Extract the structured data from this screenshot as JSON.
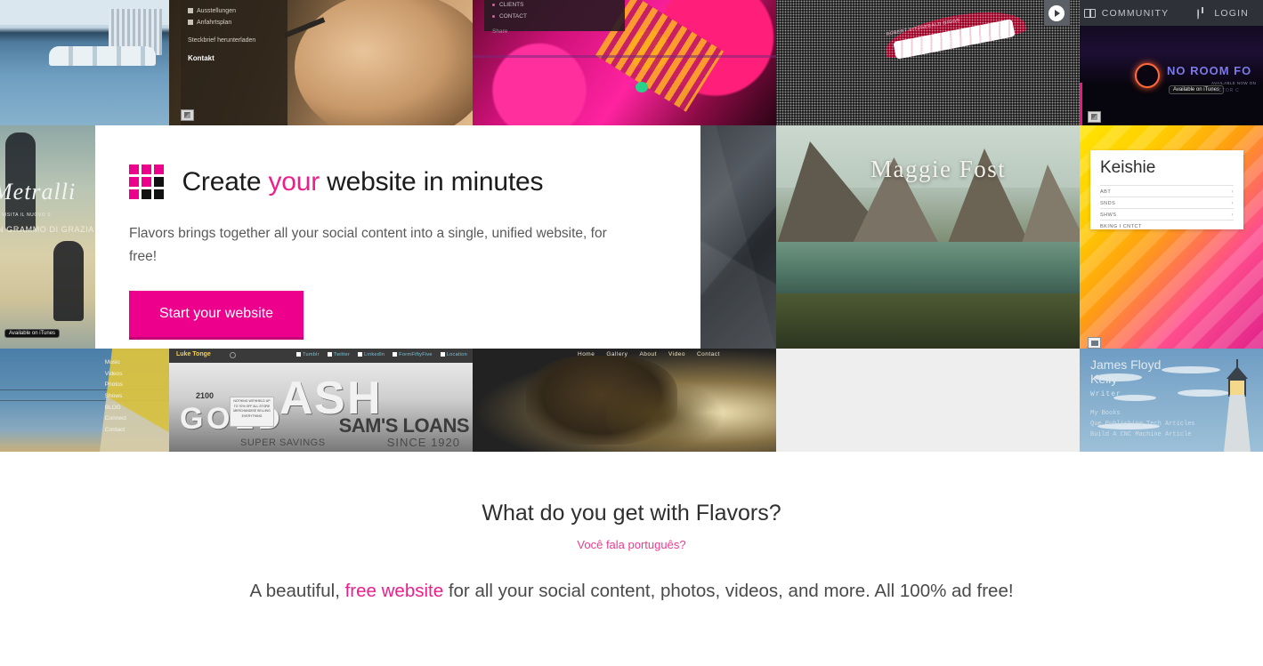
{
  "header": {
    "play_label": "play-video",
    "community_label": "COMMUNITY",
    "login_label": "LOGIN"
  },
  "hero_card": {
    "heading_part1": "Create ",
    "heading_highlight": "your",
    "heading_part2": " website in minutes",
    "paragraph": "Flavors brings together all your social content into a single, unified website, for free!",
    "cta_label": "Start your website",
    "accent_color": "#ec008c",
    "logo_cells": [
      "#ec008c",
      "#ec008c",
      "#ec008c",
      "#ec008c",
      "#ec008c",
      "#111111",
      "#ec008c",
      "#111111",
      "#111111"
    ]
  },
  "tiles": {
    "waiting_room": {
      "name": "waiting-room-site"
    },
    "german_site": {
      "nav": [
        "Ausstellungen",
        "Anfahrtsplan"
      ],
      "download": "Steckbrief herunterladen",
      "contact": "Kontakt"
    },
    "graffiti_site": {
      "nav": [
        "CLIENTS",
        "CONTACT"
      ],
      "share": "Share"
    },
    "lips_site": {
      "credit": "ROBERT FITZGERALD DIGGS"
    },
    "music_site": {
      "title": "NO ROOM FO",
      "itunes": "Available on iTunes",
      "sub": "AVAILABLE NOW ON",
      "sub2": "FACTOR     C"
    },
    "metralli_site": {
      "title": "Metralli",
      "subtitle": "VISITA IL NUOVO S",
      "album": "UN GRAMMO DI GRAZIA",
      "itunes": "Available on iTunes"
    },
    "polygon_site": {
      "name": "polygon-texture-site"
    },
    "mountain_site": {
      "name": "Maggie Fost"
    },
    "keishie_site": {
      "title": "Keishie",
      "rows": [
        "ABT",
        "SNDS",
        "SHWS"
      ],
      "footer": "BKING I CNTCT",
      "chevron": "›"
    },
    "sky_site": {
      "nav": [
        "Music",
        "Videos",
        "Photos",
        "Shows",
        "BLOG",
        "Connect",
        "Contact"
      ]
    },
    "luke_tonge_site": {
      "brand": "Luke Tonge",
      "nav": [
        "Tumblr",
        "Twitter",
        "LinkedIn",
        "FormFiftyFive",
        "Location"
      ],
      "sign_sam": "SAM'S LOANS",
      "sign_since": "SINCE 1920",
      "sign_super": "SUPER SAVINGS",
      "sign_2100": "2100",
      "sign_letters": [
        "G",
        "O",
        "L",
        "D",
        "A",
        "S",
        "H"
      ],
      "sign_notice": "NOTHING WITHHELD UP TO 70% OFF ALL STORE MERCHANDISE SELLING EVERYTHING"
    },
    "fire_site": {
      "nav": [
        "Home",
        "Gallery",
        "About",
        "Video",
        "Contact"
      ]
    },
    "empty_tile": {
      "background": "#eeeeee"
    },
    "lighthouse_site": {
      "name_line1": "James Floyd",
      "name_line2": "Kelly",
      "role": "Writer",
      "links": [
        "My Books",
        "Que Publishing Tech Articles",
        "Build A CNC Machine Article"
      ]
    }
  },
  "below": {
    "heading": "What do you get with Flavors?",
    "portuguese_link": "Você fala português?",
    "blurb_part1": "A beautiful, ",
    "blurb_highlight": "free website",
    "blurb_part2": " for all your social content, photos, videos, and more. All 100% ad free!"
  }
}
